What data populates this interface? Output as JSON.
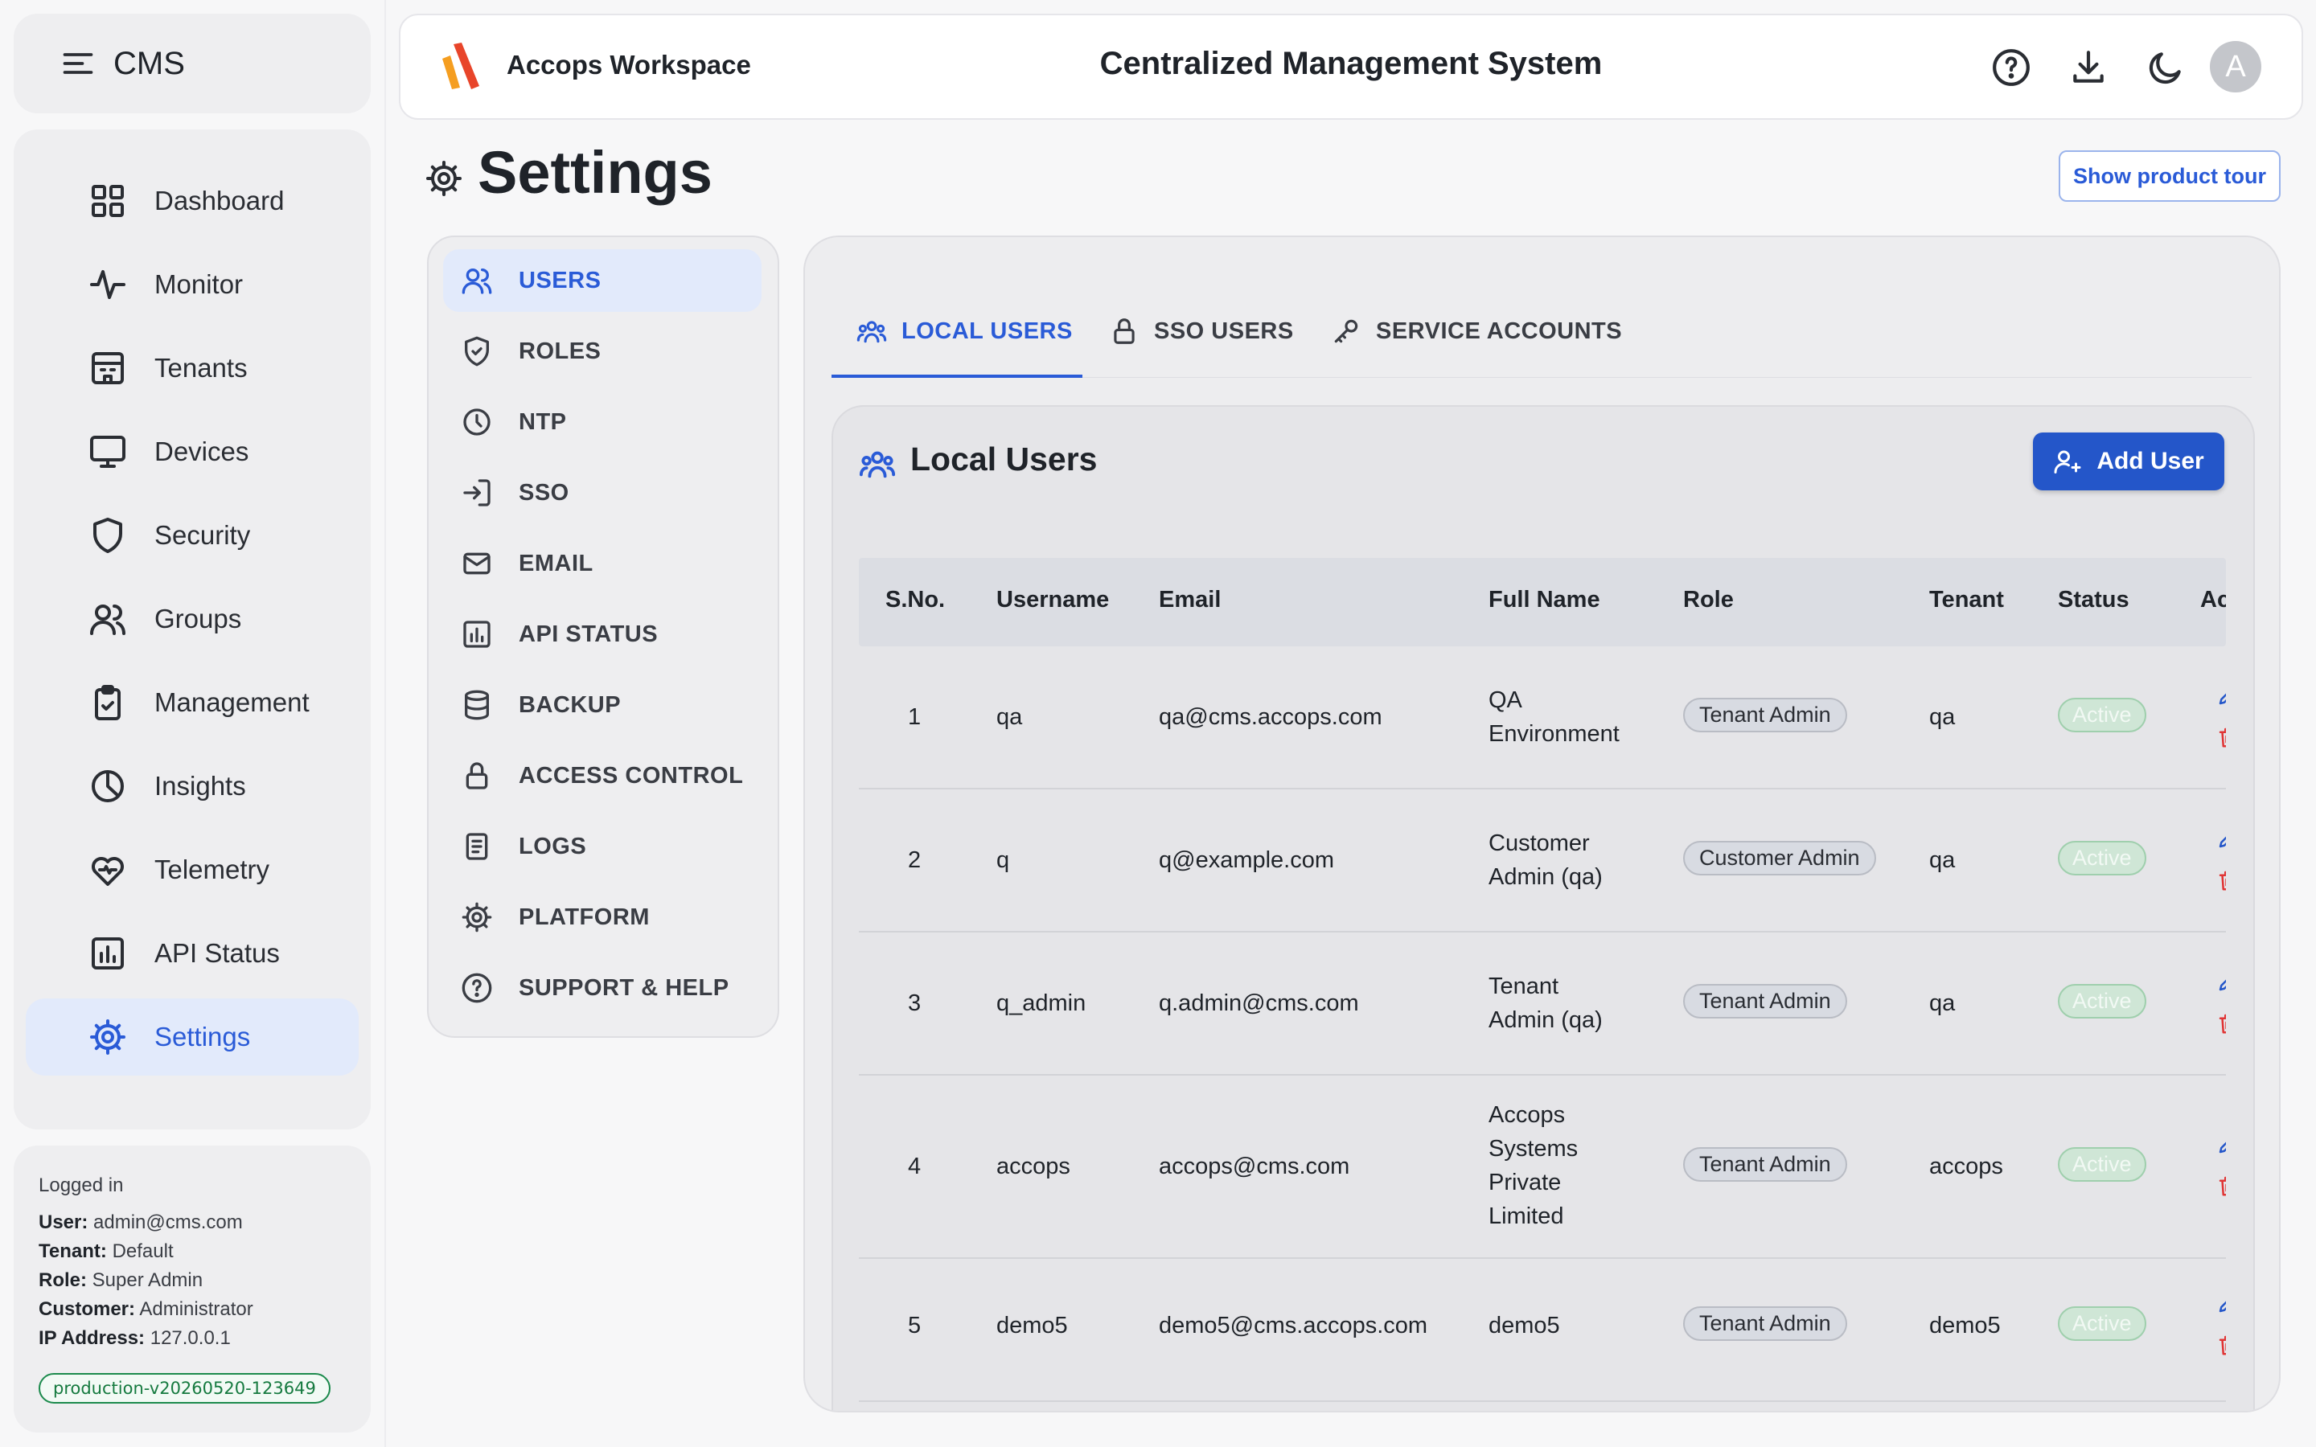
{
  "sidebar": {
    "brand": "CMS",
    "items": [
      {
        "label": "Dashboard",
        "icon": "grid-icon"
      },
      {
        "label": "Monitor",
        "icon": "activity-icon"
      },
      {
        "label": "Tenants",
        "icon": "building-icon"
      },
      {
        "label": "Devices",
        "icon": "monitor-icon"
      },
      {
        "label": "Security",
        "icon": "shield-icon"
      },
      {
        "label": "Groups",
        "icon": "users-icon"
      },
      {
        "label": "Management",
        "icon": "clipboard-check-icon"
      },
      {
        "label": "Insights",
        "icon": "pie-chart-icon"
      },
      {
        "label": "Telemetry",
        "icon": "heart-pulse-icon"
      },
      {
        "label": "API Status",
        "icon": "bar-chart-icon"
      },
      {
        "label": "Settings",
        "icon": "gear-icon",
        "active": true
      }
    ],
    "info": {
      "heading": "Logged in",
      "user_label": "User:",
      "user": "admin@cms.com",
      "tenant_label": "Tenant:",
      "tenant": "Default",
      "role_label": "Role:",
      "role": "Super Admin",
      "customer_label": "Customer:",
      "customer": "Administrator",
      "ip_label": "IP Address:",
      "ip": "127.0.0.1",
      "version": "production-v20260520-123649"
    }
  },
  "header": {
    "workspace": "Accops Workspace",
    "title": "Centralized Management System",
    "avatar_letter": "A",
    "icons": [
      "help-circle-icon",
      "download-icon",
      "moon-icon"
    ]
  },
  "page": {
    "title": "Settings",
    "tour_button": "Show product tour"
  },
  "settings_menu": [
    {
      "label": "USERS",
      "icon": "users-icon",
      "active": true
    },
    {
      "label": "ROLES",
      "icon": "shield-check-icon"
    },
    {
      "label": "NTP",
      "icon": "clock-icon"
    },
    {
      "label": "SSO",
      "icon": "login-icon"
    },
    {
      "label": "EMAIL",
      "icon": "mail-icon"
    },
    {
      "label": "API STATUS",
      "icon": "bar-chart-icon"
    },
    {
      "label": "BACKUP",
      "icon": "database-icon"
    },
    {
      "label": "ACCESS CONTROL",
      "icon": "lock-icon"
    },
    {
      "label": "LOGS",
      "icon": "file-text-icon"
    },
    {
      "label": "PLATFORM",
      "icon": "gear-icon"
    },
    {
      "label": "SUPPORT & HELP",
      "icon": "help-circle-icon"
    }
  ],
  "tabs": [
    {
      "label": "LOCAL USERS",
      "icon": "users-group-icon",
      "active": true
    },
    {
      "label": "SSO USERS",
      "icon": "lock-icon"
    },
    {
      "label": "SERVICE ACCOUNTS",
      "icon": "key-icon"
    }
  ],
  "local_users": {
    "title": "Local Users",
    "add_button": "Add User",
    "columns": [
      "S.No.",
      "Username",
      "Email",
      "Full Name",
      "Role",
      "Tenant",
      "Status",
      "Ac"
    ],
    "rows": [
      {
        "sno": "1",
        "username": "qa",
        "email": "qa@cms.accops.com",
        "full_name": [
          "QA",
          "Environment"
        ],
        "role": "Tenant Admin",
        "tenant": "qa",
        "status": "Active"
      },
      {
        "sno": "2",
        "username": "q",
        "email": "q@example.com",
        "full_name": [
          "Customer",
          "Admin (qa)"
        ],
        "role": "Customer Admin",
        "tenant": "qa",
        "status": "Active"
      },
      {
        "sno": "3",
        "username": "q_admin",
        "email": "q.admin@cms.com",
        "full_name": [
          "Tenant",
          "Admin (qa)"
        ],
        "role": "Tenant Admin",
        "tenant": "qa",
        "status": "Active"
      },
      {
        "sno": "4",
        "username": "accops",
        "email": "accops@cms.com",
        "full_name": [
          "Accops",
          "Systems",
          "Private",
          "Limited"
        ],
        "role": "Tenant Admin",
        "tenant": "accops",
        "status": "Active"
      },
      {
        "sno": "5",
        "username": "demo5",
        "email": "demo5@cms.accops.com",
        "full_name": [
          "demo5"
        ],
        "role": "Tenant Admin",
        "tenant": "demo5",
        "status": "Active"
      }
    ]
  }
}
